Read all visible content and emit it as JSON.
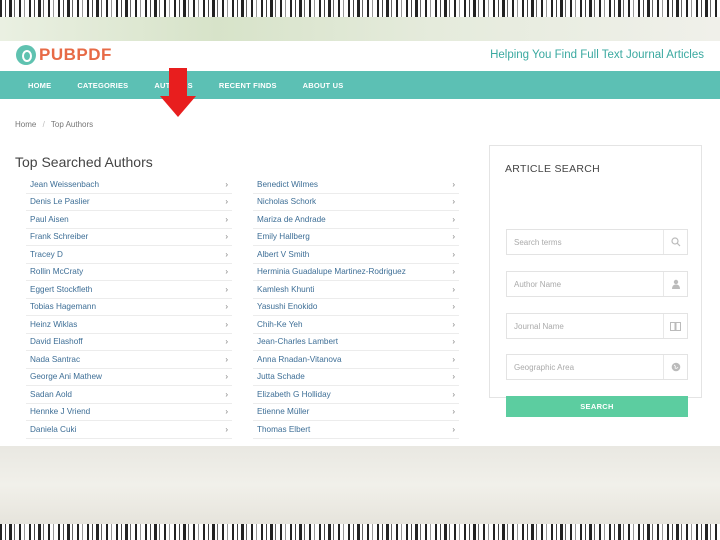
{
  "brand": {
    "logo_text": "PUBPDF",
    "tagline": "Helping You Find Full Text Journal Articles",
    "logo_color": "#e76a46",
    "accent_color": "#5cc0b4"
  },
  "nav": {
    "items": [
      "HOME",
      "CATEGORIES",
      "AUTHORS",
      "RECENT FINDS",
      "ABOUT US"
    ]
  },
  "breadcrumb": {
    "home": "Home",
    "separator": "/",
    "current": "Top Authors"
  },
  "page_title": "Top Searched Authors",
  "authors_left": [
    "Jean Weissenbach",
    "Denis Le Paslier",
    "Paul Aisen",
    "Frank Schreiber",
    "Tracey D",
    "Rollin McCraty",
    "Eggert Stockfleth",
    "Tobias Hagemann",
    "Heinz Wiklas",
    "David Elashoff",
    "Nada Santrac",
    "George Ani Mathew",
    "Sadan Aold",
    "Hennke J Vriend",
    "Daniela Cuki"
  ],
  "authors_right": [
    "Benedict Wilmes",
    "Nicholas Schork",
    "Mariza de Andrade",
    "Emily Hallberg",
    "Albert V Smith",
    "Herminia Guadalupe Martinez-Rodriguez",
    "Kamlesh Khunti",
    "Yasushi Enokido",
    "Chih-Ke Yeh",
    "Jean-Charles Lambert",
    "Anna Rnadan-Vitanova",
    "Jutta Schade",
    "Elizabeth G Holliday",
    "Etienne Müller",
    "Thomas Elbert"
  ],
  "article_search": {
    "title": "ARTICLE SEARCH",
    "fields": [
      {
        "placeholder": "Search terms",
        "icon": "search-icon"
      },
      {
        "placeholder": "Author Name",
        "icon": "user-icon"
      },
      {
        "placeholder": "Journal Name",
        "icon": "book-icon"
      },
      {
        "placeholder": "Geographic Area",
        "icon": "globe-icon"
      }
    ],
    "button_label": "SEARCH",
    "button_color": "#5ccda0"
  }
}
